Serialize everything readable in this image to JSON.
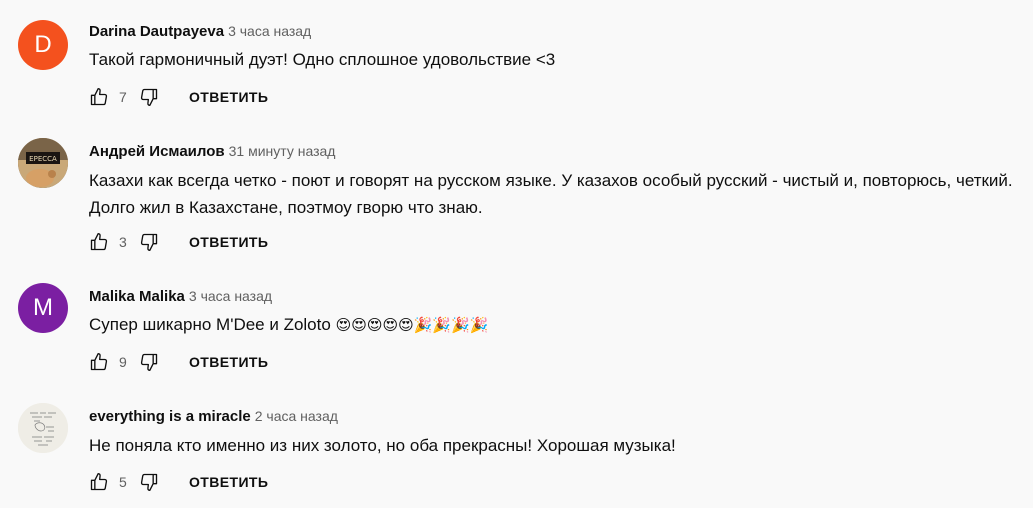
{
  "comments": [
    {
      "author": "Darina Dautpayeva",
      "time": "3 часа назад",
      "text": "Такой гармоничный дуэт! Одно сплошное удовольствие <3",
      "likes": "7",
      "reply": "ОТВЕТИТЬ",
      "avatar": {
        "type": "letter",
        "letter": "D",
        "color": "#f4511e"
      }
    },
    {
      "author": "Андрей Исмаилов",
      "time": "31 минуту назад",
      "text": "Казахи как всегда четко - поют и говорят на русском языке. У казахов особый русский - чистый и, повторюсь, четкий. Долго жил в Казахстане, поэтмоу гворю что знаю.",
      "likes": "3",
      "reply": "ОТВЕТИТЬ",
      "avatar": {
        "type": "photo",
        "label": "ЕРЕССА"
      }
    },
    {
      "author": "Malika Malika",
      "time": "3 часа назад",
      "text": "Супер шикарно M'Dee и Zoloto",
      "emojis": "😍😍😍😍😍🎉🎉🎉🎉",
      "likes": "9",
      "reply": "ОТВЕТИТЬ",
      "avatar": {
        "type": "letter",
        "letter": "M",
        "color": "#7b1fa2"
      }
    },
    {
      "author": "everything is a miracle",
      "time": "2 часа назад",
      "text": "Не поняла кто именно из них золото, но оба прекрасны! Хорошая музыка!",
      "likes": "5",
      "reply": "ОТВЕТИТЬ",
      "avatar": {
        "type": "sketch"
      }
    }
  ],
  "icons": {
    "like": "thumbs-up-icon",
    "dislike": "thumbs-down-icon"
  }
}
